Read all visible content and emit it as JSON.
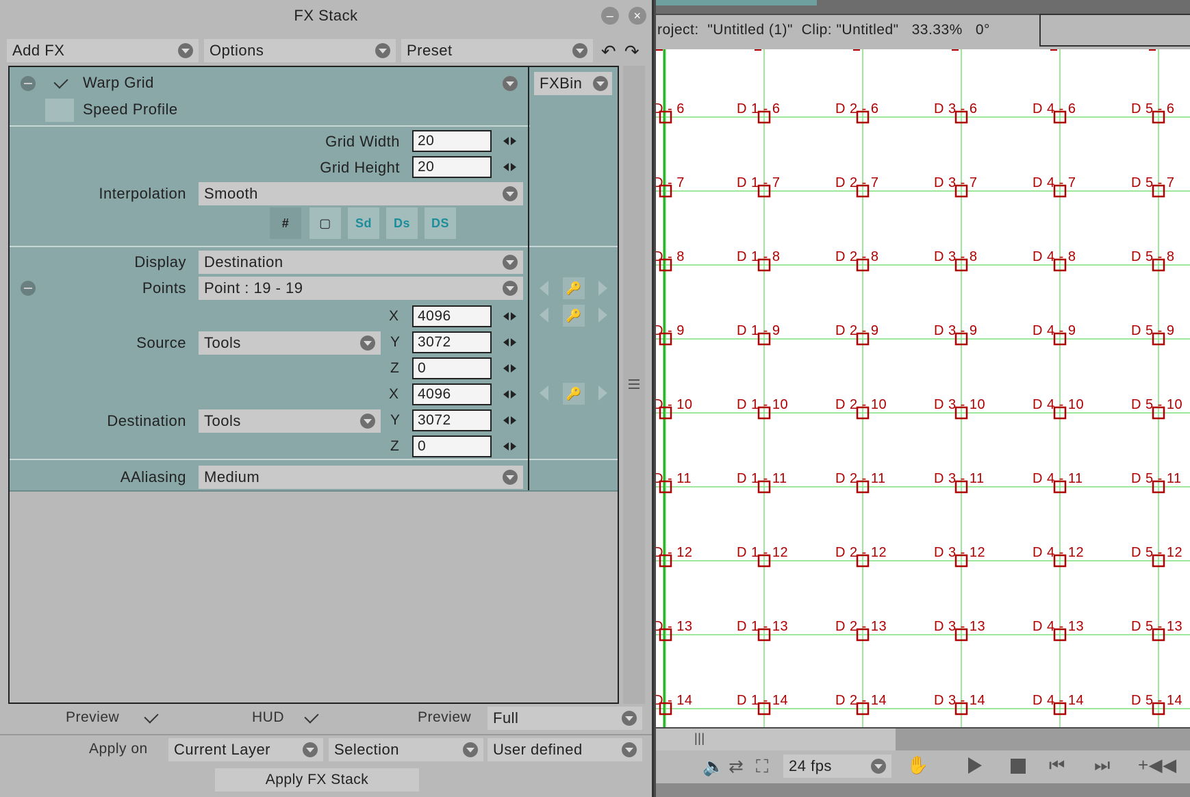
{
  "panel": {
    "title": "FX Stack",
    "toolbar": {
      "add_fx": "Add FX",
      "options": "Options",
      "preset": "Preset"
    },
    "fx_list": [
      {
        "label": "Warp Grid",
        "checked": true
      },
      {
        "label": "Speed Profile",
        "checked": false
      }
    ],
    "fxbin": "FXBin",
    "grid_width": {
      "label": "Grid Width",
      "value": "20"
    },
    "grid_height": {
      "label": "Grid Height",
      "value": "20"
    },
    "interpolation": {
      "label": "Interpolation",
      "value": "Smooth"
    },
    "grid_buttons": [
      "grid-icon",
      "frame-icon",
      "source-to-dest-icon",
      "dest-to-source-icon",
      "dest-source-swap-icon"
    ],
    "display": {
      "label": "Display",
      "value": "Destination"
    },
    "points": {
      "label": "Points",
      "value": "Point : 19 - 19"
    },
    "source": {
      "label": "Source",
      "value": "Tools",
      "x": "4096",
      "y": "3072",
      "z": "0"
    },
    "destination": {
      "label": "Destination",
      "value": "Tools",
      "x": "4096",
      "y": "3072",
      "z": "0"
    },
    "axis": {
      "x": "X",
      "y": "Y",
      "z": "Z"
    },
    "aaliasing": {
      "label": "AAliasing",
      "value": "Medium"
    },
    "footer": {
      "preview_label": "Preview",
      "hud_label": "HUD",
      "preview2_label": "Preview",
      "preview2_value": "Full",
      "apply_on_label": "Apply on",
      "apply_on_value": "Current Layer",
      "selection_value": "Selection",
      "user_defined_value": "User defined",
      "apply_button": "Apply FX Stack"
    }
  },
  "viewer": {
    "project_info": "roject:  \"Untitled (1)\"  Clip: \"Untitled\"   33.33%   0°",
    "fps": "24 fps",
    "grid_rows": [
      "6",
      "7",
      "8",
      "9",
      "10",
      "11",
      "12",
      "13",
      "14"
    ],
    "grid_cols": [
      "D",
      "D 1",
      "D 2",
      "D 3",
      "D 4",
      "D 5"
    ],
    "point_color": "#b00000",
    "line_color": "#7ee07e"
  }
}
